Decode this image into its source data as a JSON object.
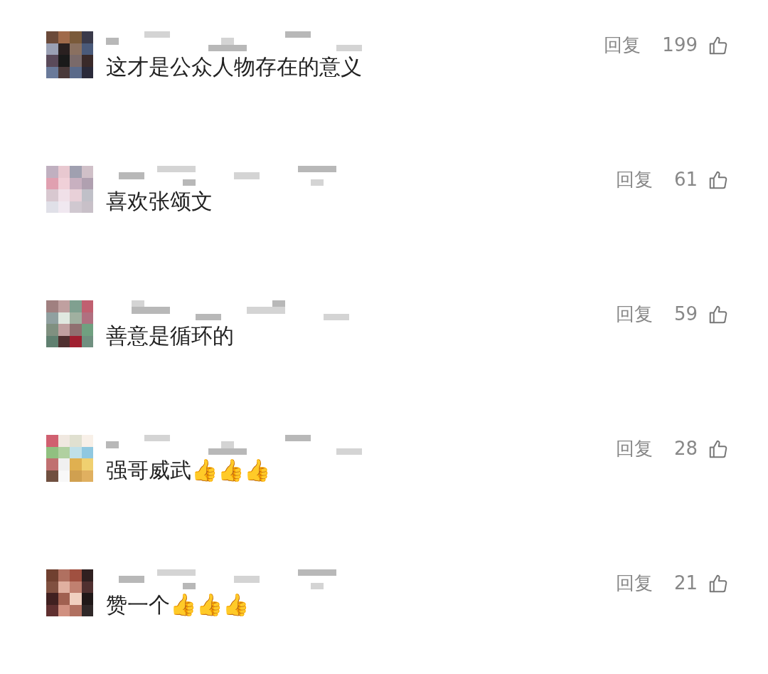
{
  "comments": [
    {
      "text": "这才是公众人物存在的意义",
      "reply": "回复",
      "likes": "199"
    },
    {
      "text": "喜欢张颂文",
      "reply": "回复",
      "likes": "61"
    },
    {
      "text": "善意是循环的",
      "reply": "回复",
      "likes": "59"
    },
    {
      "text": "强哥威武👍👍👍",
      "reply": "回复",
      "likes": "28"
    },
    {
      "text": "赞一个👍👍👍",
      "reply": "回复",
      "likes": "21"
    }
  ]
}
